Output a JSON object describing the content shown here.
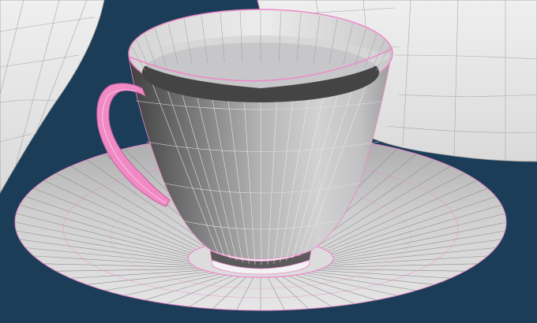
{
  "scene": {
    "background_color": "#1b3d58",
    "wire_color": "#ee88c8",
    "surface_color": "#d9d9db",
    "shaded_color": "#6f6f70",
    "objects": [
      {
        "name": "teacup",
        "icon": "teacup-mesh",
        "selected": false
      },
      {
        "name": "handle",
        "icon": "handle-mesh",
        "selected": true
      },
      {
        "name": "saucer",
        "icon": "saucer-mesh",
        "selected": false
      },
      {
        "name": "background-props",
        "icon": "prop-mesh",
        "selected": false
      }
    ]
  }
}
